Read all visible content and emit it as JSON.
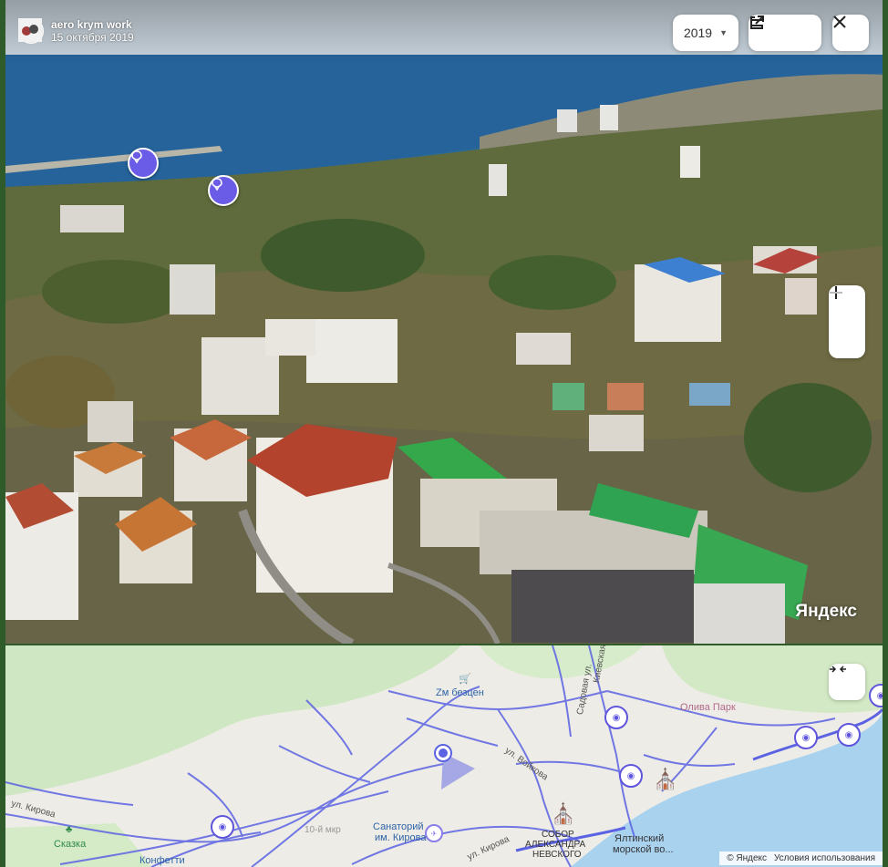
{
  "panorama": {
    "author": {
      "name": "aero krym work",
      "date": "15 октября 2019"
    },
    "year_selector": {
      "value": "2019"
    },
    "watermark": "Яндекс",
    "icons": {
      "share": "external-link-icon",
      "menu": "menu-icon",
      "close": "close-icon",
      "zoom_in": "plus-icon",
      "zoom_out": "minus-icon",
      "pin": "panorama-balloon-icon"
    }
  },
  "map": {
    "labels": {
      "zm_bezcen": "Zм безцен",
      "oliva_park": "Олива Парк",
      "kievskaya": "Киевская",
      "sadovaya": "Садовая ул.",
      "voykova": "ул. Войкова",
      "kirova_left": "ул. Кирова",
      "kirova_bottom": "ул. Кирова",
      "skazka": "Сказка",
      "konfetti": "Конфетти",
      "sanatory_1": "Санаторий",
      "sanatory_2": "им. Кирова",
      "microdistrict": "10-й мкр",
      "sobor_1": "СОБОР",
      "sobor_2": "АЛЕКСАНДРА",
      "sobor_3": "НЕВСКОГО",
      "port_1": "Ялтинский",
      "port_2": "морской во..."
    },
    "copyright": "© Яндекс",
    "terms": "Условия использования",
    "colors": {
      "route": "#5b63e3",
      "sea": "#a9d2ef",
      "park": "#cfe7c2",
      "accent": "#6b5ce7"
    }
  }
}
